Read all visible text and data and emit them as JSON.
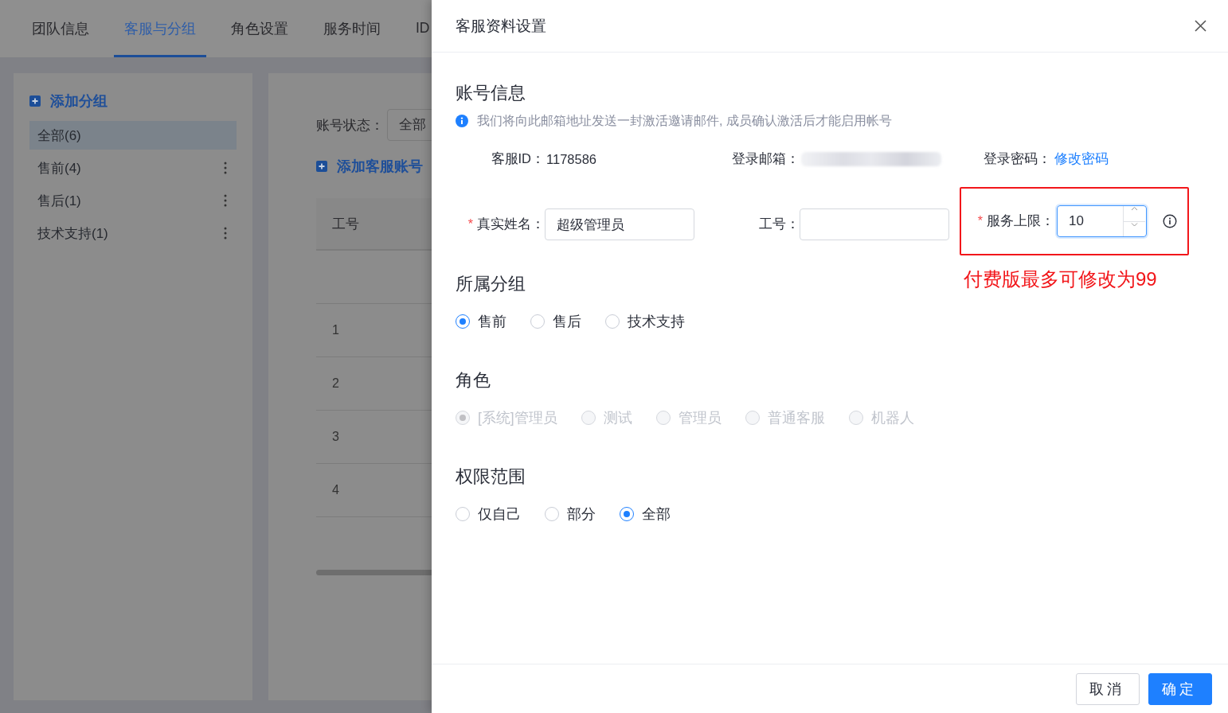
{
  "background": {
    "tabs": [
      {
        "label": "团队信息",
        "selected": false
      },
      {
        "label": "客服与分组",
        "selected": true
      },
      {
        "label": "角色设置",
        "selected": false
      },
      {
        "label": "服务时间",
        "selected": false
      },
      {
        "label": "ID",
        "selected": false
      }
    ],
    "group_panel": {
      "add_label": "添加分组",
      "items": [
        {
          "label": "全部(6)",
          "selected": true,
          "menu": false
        },
        {
          "label": "售前(4)",
          "selected": false,
          "menu": true
        },
        {
          "label": "售后(1)",
          "selected": false,
          "menu": true
        },
        {
          "label": "技术支持(1)",
          "selected": false,
          "menu": true
        }
      ]
    },
    "account_panel": {
      "status_label": "账号状态：",
      "status_value": "全部",
      "add_label": "添加客服账号",
      "column_1": "工号",
      "rows": [
        "1",
        "2",
        "3",
        "4"
      ]
    }
  },
  "drawer": {
    "title": "客服资料设置",
    "account": {
      "heading": "账号信息",
      "notice": "我们将向此邮箱地址发送一封激活邀请邮件, 成员确认激活后才能启用帐号",
      "id_label": "客服ID：",
      "id_value": "1178586",
      "email_label": "登录邮箱：",
      "password_label": "登录密码：",
      "password_link": "修改密码",
      "name_field": {
        "required_mark": "*",
        "label": "真实姓名：",
        "value": "超级管理员"
      },
      "number_field": {
        "label": "工号："
      },
      "limit_field": {
        "required_mark": "*",
        "label": "服务上限：",
        "value": "10",
        "focused": true,
        "highlighted": true,
        "note": "付费版最多可修改为99"
      }
    },
    "radio_groups": [
      {
        "heading": "所属分组",
        "disabled": false,
        "options": [
          {
            "label": "售前",
            "selected": true
          },
          {
            "label": "售后",
            "selected": false
          },
          {
            "label": "技术支持",
            "selected": false
          }
        ]
      },
      {
        "heading": "角色",
        "disabled": true,
        "options": [
          {
            "label": "[系统]管理员",
            "selected": true
          },
          {
            "label": "测试",
            "selected": false
          },
          {
            "label": "管理员",
            "selected": false
          },
          {
            "label": "普通客服",
            "selected": false
          },
          {
            "label": "机器人",
            "selected": false
          }
        ]
      },
      {
        "heading": "权限范围",
        "disabled": false,
        "options": [
          {
            "label": "仅自己",
            "selected": false
          },
          {
            "label": "部分",
            "selected": false
          },
          {
            "label": "全部",
            "selected": true
          }
        ]
      }
    ],
    "buttons": [
      {
        "label": "取消",
        "kind": "secondary"
      },
      {
        "label": "确定",
        "kind": "primary"
      }
    ]
  }
}
